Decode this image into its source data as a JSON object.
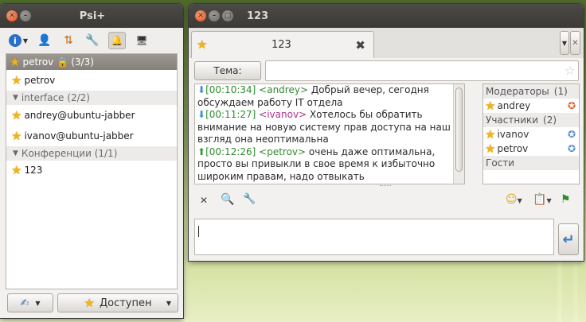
{
  "roster_window": {
    "title": "Psi+",
    "self_group": {
      "label": "petrov",
      "count": "(3/3)"
    },
    "self_contact": "petrov",
    "groups": [
      {
        "label": "interface (2/2)",
        "contacts": [
          "andrey@ubuntu-jabber",
          "ivanov@ubuntu-jabber"
        ]
      },
      {
        "label": "Конференции (1/1)",
        "contacts": [
          "123"
        ]
      }
    ],
    "status_button": "Доступен"
  },
  "chat_window": {
    "title": "123",
    "tab_label": "123",
    "topic_button": "Тема:",
    "topic_value": "",
    "messages": [
      {
        "time": "[00:10:34]",
        "nick": "<andrey>",
        "text": "Добрый вечер, сегодня",
        "cont": "обсуждаем работу IT отдела"
      },
      {
        "time": "[00:11:27]",
        "nick": "<ivanov>",
        "text": "Хотелось бы обратить",
        "cont": "внимание на новую систему прав доступа на наш",
        "cont2": "взгляд она неоптимальна"
      },
      {
        "time": "[00:12:26]",
        "nick": "<petrov>",
        "text": "очень даже оптимальна,",
        "cont": "просто вы привыкли в свое время к избыточно",
        "cont2": "широким правам, надо отвыкать"
      }
    ],
    "occupants": {
      "moderators_label": "Модераторы",
      "moderators_count": "(1)",
      "moderators": [
        "andrey"
      ],
      "participants_label": "Участники",
      "participants_count": "(2)",
      "participants": [
        "ivanov",
        "petrov"
      ],
      "guests_label": "Гости"
    },
    "input_value": ""
  }
}
